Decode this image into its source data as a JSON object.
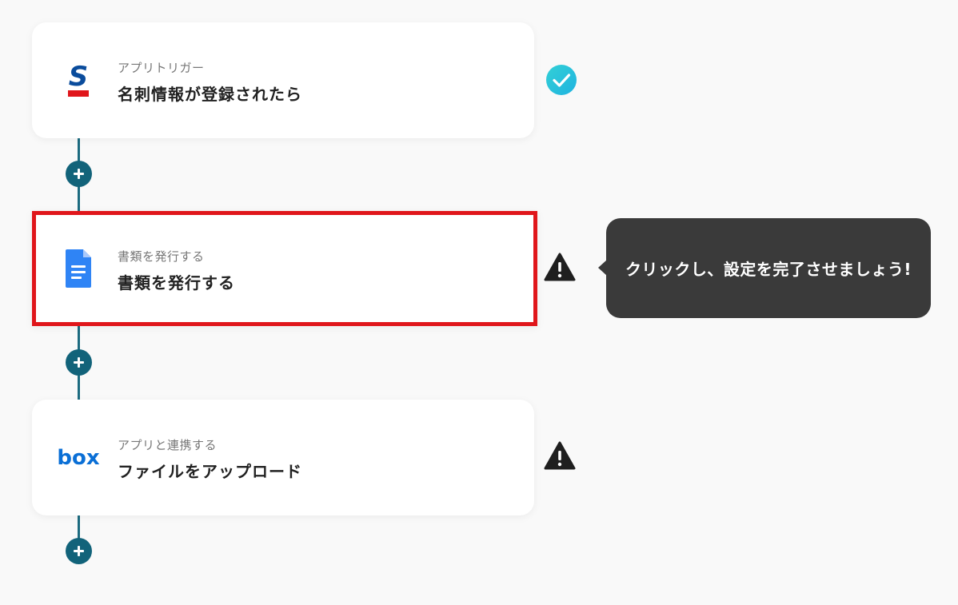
{
  "flow": {
    "steps": [
      {
        "sub_label": "アプリトリガー",
        "title": "名刺情報が登録されたら",
        "icon": "sansan-logo-icon",
        "status": "complete"
      },
      {
        "sub_label": "書類を発行する",
        "title": "書類を発行する",
        "icon": "google-docs-icon",
        "status": "warning"
      },
      {
        "sub_label": "アプリと連携する",
        "title": "ファイルをアップロード",
        "icon": "box-logo-icon",
        "status": "warning"
      }
    ]
  },
  "tooltip": {
    "text": "クリックし、設定を完了させましょう!"
  },
  "logos": {
    "box_text": "box"
  },
  "colors": {
    "connector": "#1c6b80",
    "add_button": "#12637a",
    "highlight_border": "#e0161b",
    "check_badge": "#2ec5d8",
    "warning": "#1f1f1f",
    "tooltip_bg": "#3a3a3a",
    "sansan_blue": "#0a4c9c",
    "sansan_red": "#e0161b",
    "gdocs_blue": "#2f84f5",
    "box_blue": "#0a6fd6"
  }
}
